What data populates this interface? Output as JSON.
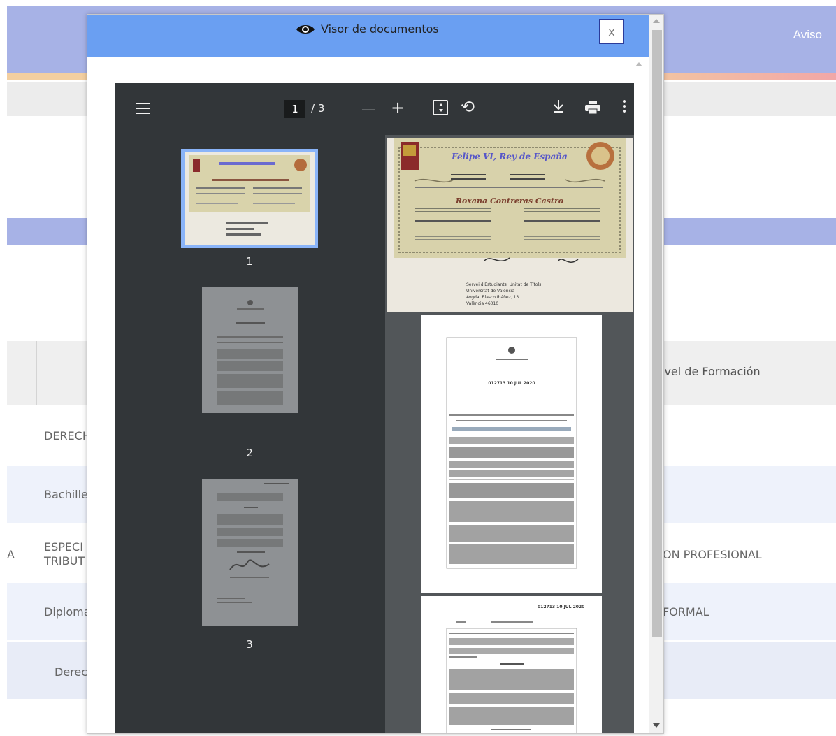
{
  "background": {
    "aviso_label": "Aviso",
    "nivel_header": "ivel de Formación",
    "rows": [
      {
        "left": "DERECH",
        "right": ""
      },
      {
        "left": "Bachille",
        "right": ""
      },
      {
        "left": "ESPECI\nTRIBUT",
        "right": "ON PROFESIONAL",
        "prefix": "A"
      },
      {
        "left": "Diploma",
        "right": "FORMAL"
      },
      {
        "left": "Derec",
        "right": ""
      }
    ]
  },
  "modal": {
    "title": "Visor de documentos",
    "close_label": "x"
  },
  "pdf_viewer": {
    "current_page": "1",
    "page_separator": "/ 3",
    "total_pages": 3,
    "thumbnails": [
      {
        "label": "1",
        "selected": true
      },
      {
        "label": "2",
        "selected": false
      },
      {
        "label": "3",
        "selected": false
      }
    ],
    "icons": {
      "menu": "menu-icon",
      "zoom_out": "minus-icon",
      "zoom_in": "plus-icon",
      "fit": "fit-to-page-icon",
      "rotate": "rotate-icon",
      "download": "download-icon",
      "print": "print-icon",
      "more": "more-vertical-icon"
    }
  },
  "document_pages": {
    "page1": {
      "heading": "Felipe VI, Rey de España",
      "recipient": "Roxana Contreras Castro",
      "footer_lines": [
        "Servei d'Estudiants. Unitat de Títols",
        "Universitat de València",
        "Avgda. Blasco Ibáñez, 13",
        "València 46010"
      ]
    },
    "page2": {
      "resolution": "012713 10 JUL 2020"
    },
    "page3": {
      "resolution": "012713 10 JUL 2020"
    }
  },
  "colors": {
    "modal_header": "#6a9ff2",
    "toolbar": "#323639",
    "viewer_bg": "#525659",
    "bg_header": "#a7b2e6",
    "thumb_selected_border": "#8ab4f8"
  }
}
